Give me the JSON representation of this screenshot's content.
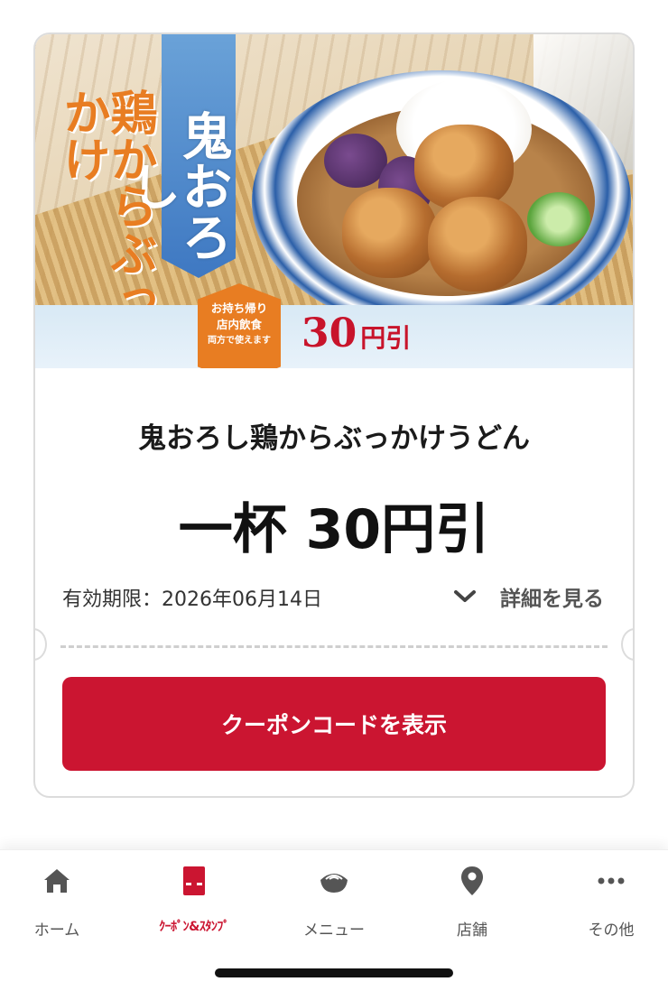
{
  "coupon": {
    "banner_vertical_text": "鬼おろし",
    "side_vertical_text": "鶏からぶっかけ",
    "badge_lines": [
      "お持ち帰り",
      "店内飲食",
      "両方で使えます"
    ],
    "banner_discount_number": "30",
    "banner_discount_unit": "円引",
    "title": "鬼おろし鶏からぶっかけうどん",
    "amount": "一杯 30円引",
    "expiry": "有効期限：2026年06月14日",
    "detail_label": "詳細を見る",
    "button_label": "クーポンコードを表示"
  },
  "tabs": [
    {
      "label": "ホーム",
      "icon": "home-icon"
    },
    {
      "label": "ｸｰﾎﾟﾝ&ｽﾀﾝﾌﾟ",
      "icon": "coupon-icon"
    },
    {
      "label": "メニュー",
      "icon": "bowl-icon"
    },
    {
      "label": "店舗",
      "icon": "location-pin-icon"
    },
    {
      "label": "その他",
      "icon": "more-icon"
    }
  ],
  "colors": {
    "accent": "#cb1531",
    "badge": "#e87d22",
    "inactive": "#555555"
  }
}
